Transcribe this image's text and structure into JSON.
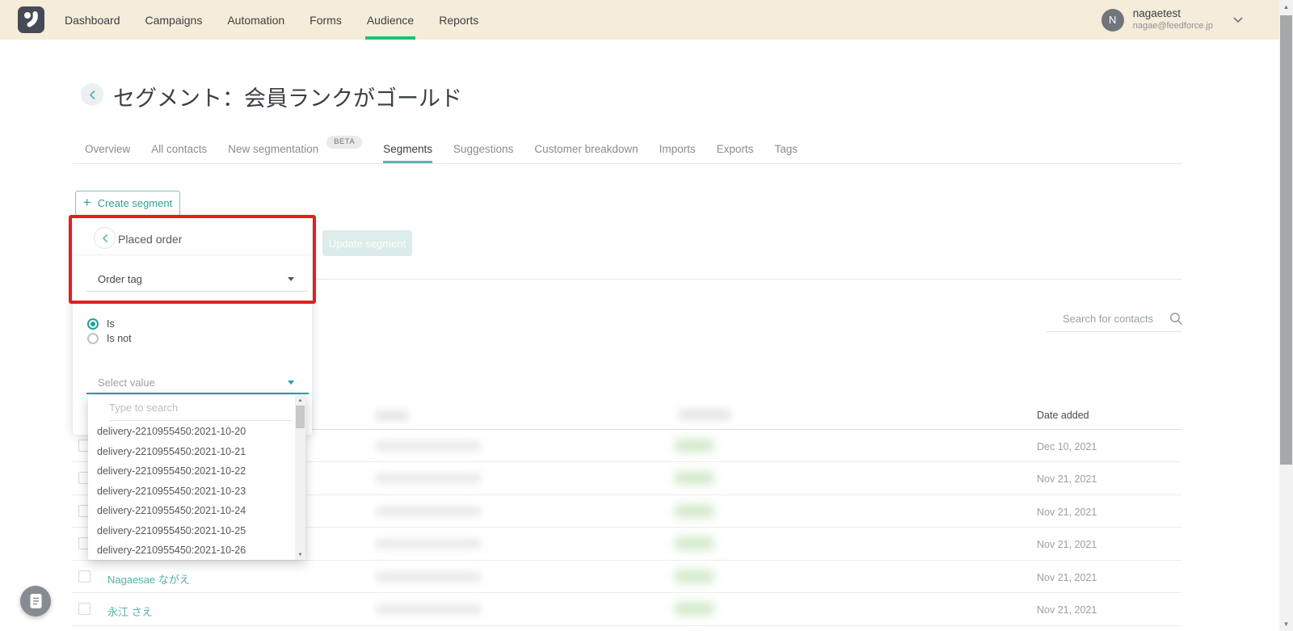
{
  "nav": {
    "items": [
      {
        "label": "Dashboard",
        "active": false
      },
      {
        "label": "Campaigns",
        "active": false
      },
      {
        "label": "Automation",
        "active": false
      },
      {
        "label": "Forms",
        "active": false
      },
      {
        "label": "Audience",
        "active": true
      },
      {
        "label": "Reports",
        "active": false
      }
    ],
    "user": {
      "initial": "N",
      "name": "nagaetest",
      "email": "nagae@feedforce.jp"
    }
  },
  "page": {
    "title": "セグメント：会員ランクがゴールド"
  },
  "tabs": [
    {
      "label": "Overview",
      "active": false
    },
    {
      "label": "All contacts",
      "active": false
    },
    {
      "label": "New segmentation",
      "badge": "BETA",
      "active": false
    },
    {
      "label": "Segments",
      "active": true
    },
    {
      "label": "Suggestions",
      "active": false
    },
    {
      "label": "Customer breakdown",
      "active": false
    },
    {
      "label": "Imports",
      "active": false
    },
    {
      "label": "Exports",
      "active": false
    },
    {
      "label": "Tags",
      "active": false
    }
  ],
  "segment_builder": {
    "create_button_label": "Create segment",
    "update_button_label": "Update segment",
    "filter_panel": {
      "title": "Placed order",
      "field_label": "Order tag",
      "operators": [
        {
          "label": "Is",
          "selected": true
        },
        {
          "label": "Is not",
          "selected": false
        }
      ],
      "value_placeholder": "Select value"
    },
    "value_dropdown": {
      "search_placeholder": "Type to search",
      "options": [
        "delivery-2210955450:2021-10-20",
        "delivery-2210955450:2021-10-21",
        "delivery-2210955450:2021-10-22",
        "delivery-2210955450:2021-10-23",
        "delivery-2210955450:2021-10-24",
        "delivery-2210955450:2021-10-25",
        "delivery-2210955450:2021-10-26"
      ]
    }
  },
  "contacts": {
    "search_placeholder": "Search for contacts",
    "table": {
      "date_column_header": "Date added",
      "rows": [
        {
          "name": "",
          "date": "Dec 10, 2021"
        },
        {
          "name": "",
          "date": "Nov 21, 2021"
        },
        {
          "name": "",
          "date": "Nov 21, 2021"
        },
        {
          "name": "",
          "date": "Nov 21, 2021"
        },
        {
          "name": "Nagaesae ながえ",
          "date": "Nov 21, 2021"
        },
        {
          "name": "永江 さえ",
          "date": "Nov 21, 2021"
        }
      ]
    }
  },
  "colors": {
    "nav_background": "#f5ecd9",
    "nav_active_underline": "#22c271",
    "accent_teal": "#2fa29b",
    "tab_active_underline": "#5fb3ad",
    "link_teal": "#53b1ad",
    "annotation_red": "#e0201f",
    "disabled_button_bg": "#dbecea"
  }
}
